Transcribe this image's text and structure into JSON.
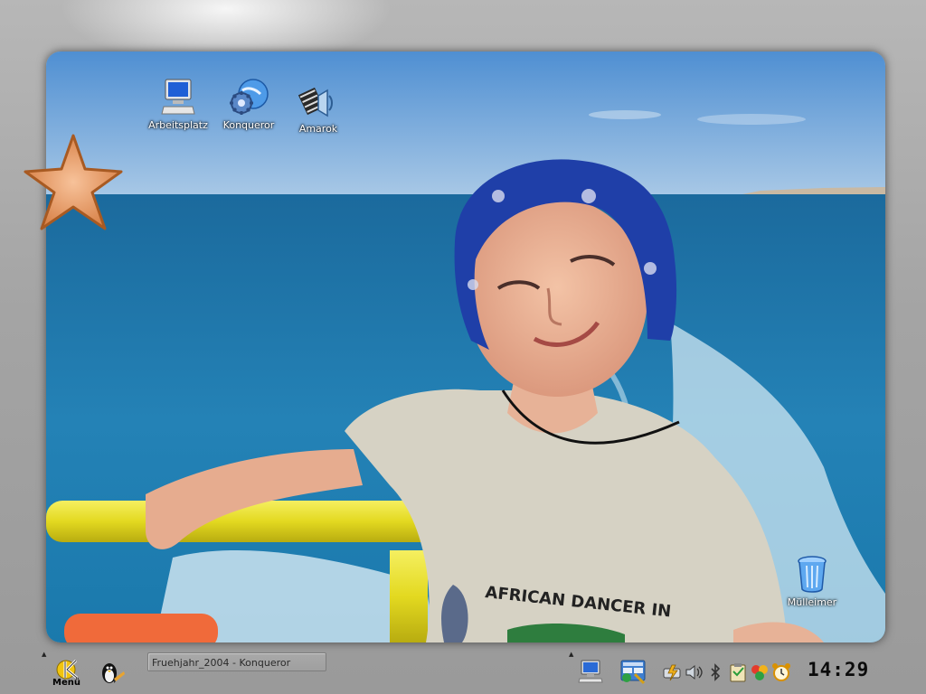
{
  "desktop": {
    "icons": [
      {
        "label": "Arbeitsplatz",
        "icon": "computer-icon"
      },
      {
        "label": "Konqueror",
        "icon": "konqueror-icon"
      },
      {
        "label": "Amarok",
        "icon": "amarok-icon"
      },
      {
        "label": "Mülleimer",
        "icon": "trash-icon"
      }
    ],
    "shirt_text": "AFRICAN DANCER IN"
  },
  "panel": {
    "kmenu_label": "Menü",
    "taskbar": [
      {
        "label": "Fruehjahr_2004 - Konqueror"
      }
    ],
    "quick_launch": [
      "home-tux-icon",
      "show-desktop-icon",
      "virtual-desktops-icon"
    ],
    "tray_icons": [
      "power-icon",
      "volume-icon",
      "bluetooth-icon",
      "klipper-icon",
      "korganizer-icon",
      "alarm-icon"
    ],
    "clock": "14:29"
  },
  "colors": {
    "sky": "#6fa3d8",
    "sea": "#1a6fa0",
    "bandana": "#1f3fa8",
    "rail": "#e8df2d",
    "frame": "#a6a6a6"
  }
}
